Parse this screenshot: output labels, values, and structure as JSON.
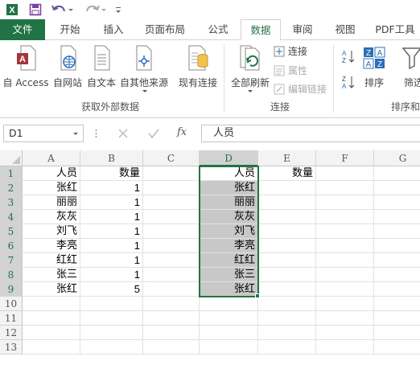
{
  "quick_access": {
    "app_icon": "excel-icon",
    "save_icon": "save-icon",
    "undo_icon": "undo-icon",
    "redo_icon": "redo-icon",
    "customize_icon": "customize-icon"
  },
  "tabs": [
    {
      "label": "文件"
    },
    {
      "label": "开始"
    },
    {
      "label": "插入"
    },
    {
      "label": "页面布局"
    },
    {
      "label": "公式"
    },
    {
      "label": "数据"
    },
    {
      "label": "审阅"
    },
    {
      "label": "视图"
    },
    {
      "label": "PDF工具"
    }
  ],
  "ribbon": {
    "get_external": {
      "group_label": "获取外部数据",
      "access": "自 Access",
      "web": "自网站",
      "text": "自文本",
      "other": "自其他来源",
      "existing": "现有连接"
    },
    "connections": {
      "group_label": "连接",
      "refresh_all": "全部刷新",
      "connections": "连接",
      "properties": "属性",
      "edit_links": "编辑链接"
    },
    "sort_filter": {
      "group_label": "排序和",
      "sort": "排序",
      "filter": "筛选"
    }
  },
  "formula_bar": {
    "name_box": "D1",
    "cancel_icon": "cancel-icon",
    "enter_icon": "enter-icon",
    "function_label": "fx",
    "content": "人员"
  },
  "sheet": {
    "columns": [
      "A",
      "B",
      "C",
      "D",
      "E",
      "F",
      "G"
    ],
    "selected_column": "D",
    "rows": [
      "1",
      "2",
      "3",
      "4",
      "5",
      "6",
      "7",
      "8",
      "9",
      "10",
      "11",
      "12",
      "13"
    ],
    "column_a": [
      "人员",
      "张红",
      "丽丽",
      "灰灰",
      "刘飞",
      "李亮",
      "红红",
      "张三",
      "张红"
    ],
    "column_b": [
      "数量",
      "1",
      "1",
      "1",
      "1",
      "1",
      "1",
      "1",
      "5"
    ],
    "column_d": [
      "人员",
      "张红",
      "丽丽",
      "灰灰",
      "刘飞",
      "李亮",
      "红红",
      "张三",
      "张红"
    ],
    "column_e": [
      "数量"
    ]
  },
  "colors": {
    "accent": "#217346",
    "highlight": "#c8c8c8"
  }
}
